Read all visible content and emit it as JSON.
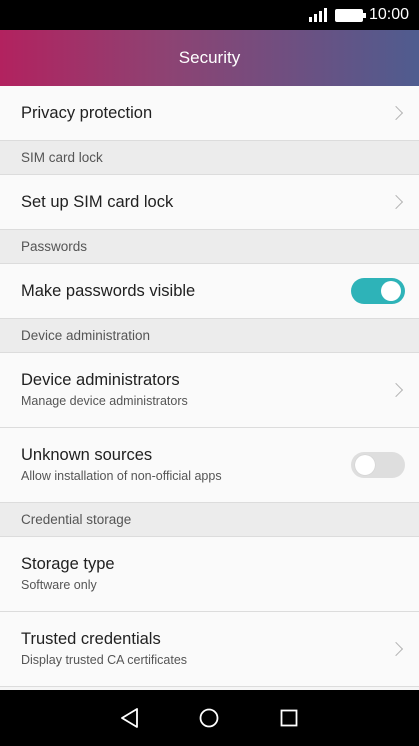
{
  "status_bar": {
    "time": "10:00",
    "icons": [
      "signal-icon",
      "battery-icon"
    ]
  },
  "app_bar": {
    "title": "Security",
    "gradient": [
      "#b2225f",
      "#8d4373",
      "#4f5c8f"
    ]
  },
  "accent_color": "#2eb3b8",
  "list": {
    "privacy_protection": {
      "label": "Privacy protection"
    },
    "sim_header": "SIM card lock",
    "sim_lock": {
      "label": "Set up SIM card lock"
    },
    "passwords_header": "Passwords",
    "passwords_visible": {
      "label": "Make passwords visible",
      "enabled": true
    },
    "device_admin_header": "Device administration",
    "device_admins": {
      "label": "Device administrators",
      "summary": "Manage device administrators"
    },
    "unknown_sources": {
      "label": "Unknown sources",
      "summary": "Allow installation of non-official apps",
      "enabled": false
    },
    "credential_header": "Credential storage",
    "storage_type": {
      "label": "Storage type",
      "summary": "Software only"
    },
    "trusted_credentials": {
      "label": "Trusted credentials",
      "summary": "Display trusted CA certificates"
    }
  },
  "nav_bar": {
    "icons": [
      "back-icon",
      "home-icon",
      "recents-icon"
    ]
  }
}
